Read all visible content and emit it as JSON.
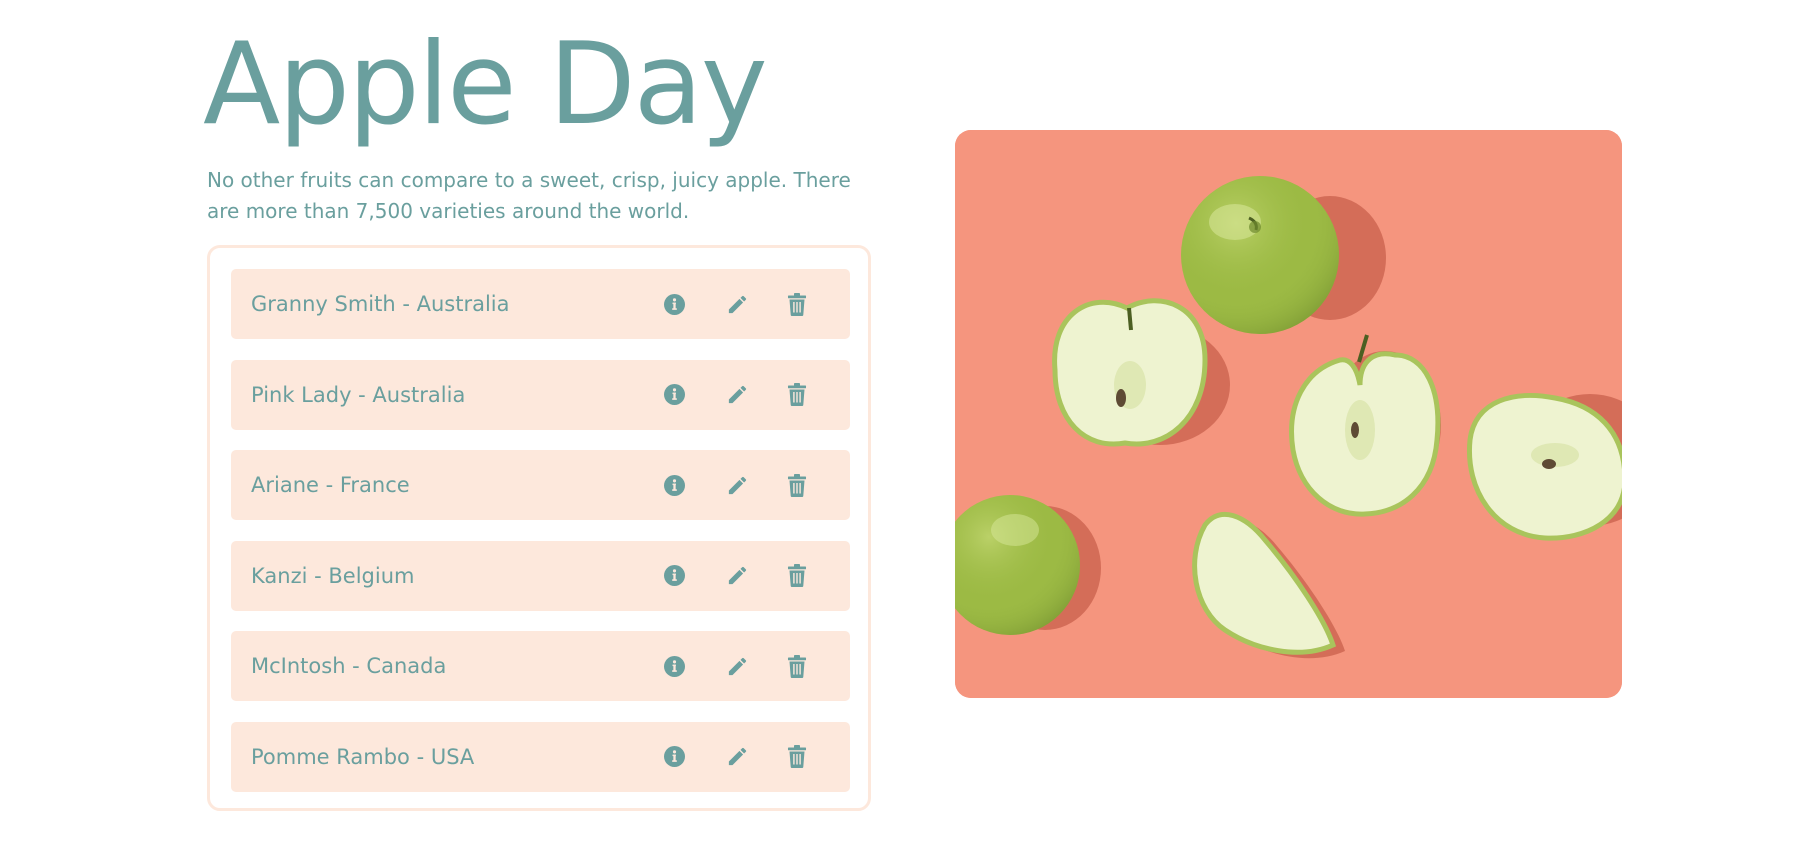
{
  "page": {
    "title": "Apple Day",
    "intro": "No other fruits can compare to a sweet, crisp, juicy apple. There are more than 7,500 varieties around the world."
  },
  "varieties": [
    {
      "label": "Granny Smith - Australia"
    },
    {
      "label": "Pink Lady - Australia"
    },
    {
      "label": "Ariane - France"
    },
    {
      "label": "Kanzi - Belgium"
    },
    {
      "label": "McIntosh - Canada"
    },
    {
      "label": "Pomme Rambo - USA"
    }
  ],
  "actions": {
    "info_icon": "info-circle-icon",
    "edit_icon": "pencil-icon",
    "delete_icon": "trash-icon"
  },
  "colors": {
    "text": "#6a9f9e",
    "item_background": "#fde8dc",
    "card_border": "#fde8dc",
    "image_background": "#f5957e",
    "apple_green": "#a8c45a"
  }
}
